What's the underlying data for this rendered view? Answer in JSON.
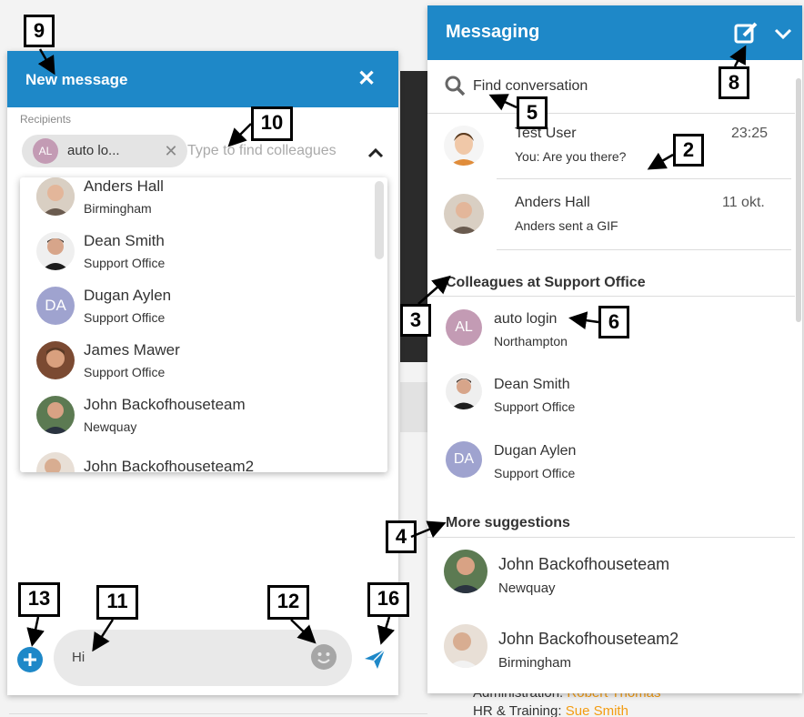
{
  "background": {
    "admin_label": "Administration:",
    "admin_value": "Robert Thomas",
    "hr_label": "HR & Training:",
    "hr_value": "Sue Smith"
  },
  "new_message": {
    "title": "New message",
    "close_icon": "close-icon",
    "recipients_label": "Recipients",
    "chip": {
      "initials": "AL",
      "label": "auto lo...",
      "avatar_color": "#c39bb4"
    },
    "input_placeholder": "Type to find colleagues",
    "dropdown": [
      {
        "name": "Anders Hall",
        "location": "Birmingham"
      },
      {
        "name": "Dean Smith",
        "location": "Support Office"
      },
      {
        "name": "Dugan Aylen",
        "location": "Support Office",
        "initials": "DA"
      },
      {
        "name": "James Mawer",
        "location": "Support Office"
      },
      {
        "name": "John Backofhouseteam",
        "location": "Newquay"
      },
      {
        "name": "John Backofhouseteam2",
        "location": ""
      }
    ],
    "composer": {
      "text": "Hi"
    }
  },
  "messaging": {
    "title": "Messaging",
    "search_placeholder": "Find conversation",
    "conversations": [
      {
        "name": "Test User",
        "preview": "You: Are you there?",
        "time": "23:25"
      },
      {
        "name": "Anders Hall",
        "preview": "Anders sent a GIF",
        "time": "11 okt."
      }
    ],
    "colleagues_heading": "Colleagues at Support Office",
    "colleagues": [
      {
        "name": "auto login",
        "location": "Northampton",
        "initials": "AL",
        "color": "#c39bb4"
      },
      {
        "name": "Dean Smith",
        "location": "Support Office"
      },
      {
        "name": "Dugan Aylen",
        "location": "Support Office",
        "initials": "DA",
        "color": "#9fa3cf"
      }
    ],
    "suggestions_heading": "More suggestions",
    "suggestions": [
      {
        "name": "John Backofhouseteam",
        "location": "Newquay"
      },
      {
        "name": "John Backofhouseteam2",
        "location": "Birmingham"
      }
    ]
  },
  "callouts": {
    "c2": "2",
    "c3": "3",
    "c4": "4",
    "c5": "5",
    "c6": "6",
    "c8": "8",
    "c9": "9",
    "c10": "10",
    "c11": "11",
    "c12": "12",
    "c13": "13",
    "c16": "16"
  },
  "colors": {
    "header_blue": "#1e88c8",
    "link_orange": "#f39c12"
  }
}
